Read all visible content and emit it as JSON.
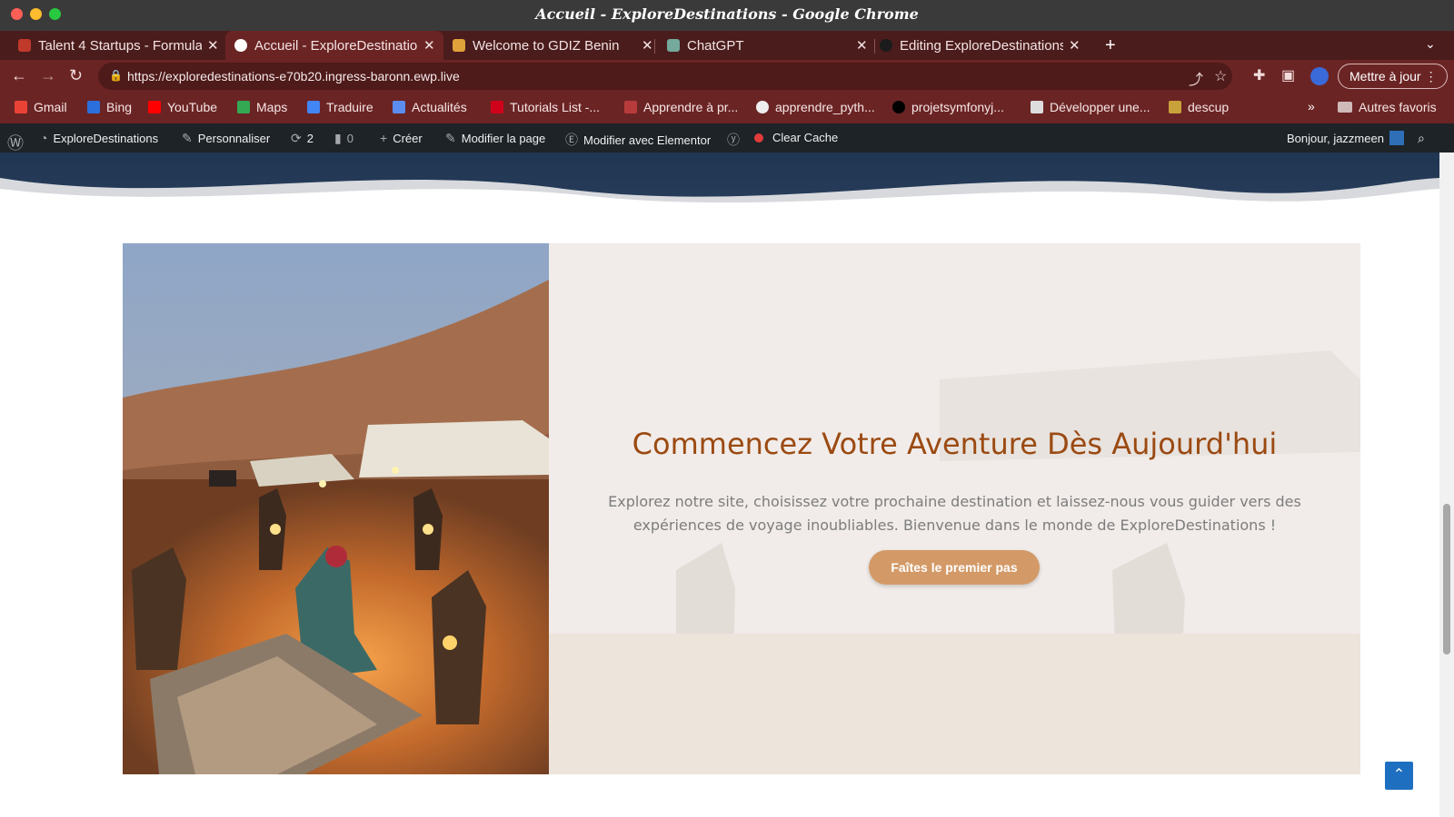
{
  "window": {
    "title": "Accueil - ExploreDestinations - Google Chrome"
  },
  "tabs": [
    {
      "label": "Talent 4 Startups - Formulaire",
      "icon": "heart-favicon"
    },
    {
      "label": "Accueil - ExploreDestinations",
      "icon": "globe-favicon",
      "active": true
    },
    {
      "label": "Welcome to GDIZ Benin",
      "icon": "gdiz-favicon"
    },
    {
      "label": "ChatGPT",
      "icon": "chatgpt-favicon"
    },
    {
      "label": "Editing ExploreDestinations",
      "icon": "github-favicon"
    }
  ],
  "toolbar": {
    "url": "https://exploredestinations-e70b20.ingress-baronn.ewp.live",
    "update_label": "Mettre à jour"
  },
  "bookmarks": {
    "items": [
      "Gmail",
      "Bing",
      "YouTube",
      "Maps",
      "Traduire",
      "Actualités",
      "Tutorials List -...",
      "Apprendre à pr...",
      "apprendre_pyth...",
      "projetsymfonyj...",
      "Développer une...",
      "descup"
    ],
    "more": "»",
    "other": "Autres favoris"
  },
  "wpbar": {
    "site": "ExploreDestinations",
    "customize": "Personnaliser",
    "updates": "2",
    "comments": "0",
    "new": "Créer",
    "edit": "Modifier la page",
    "elementor": "Modifier avec Elementor",
    "cache": "Clear Cache",
    "greeting": "Bonjour, jazzmeen"
  },
  "cta": {
    "title": "Commencez Votre Aventure Dès Aujourd'hui",
    "text": "Explorez notre site, choisissez votre prochaine destination et laissez-nous vous guider vers des expériences de voyage inoubliables. Bienvenue dans le monde de ExploreDestinations !",
    "button": "Faîtes le premier pas"
  },
  "colors": {
    "title": "#9b4a12",
    "button": "#d39a67",
    "tab_bar": "#4b1c1c",
    "toolbar": "#6b2424",
    "wp_bar": "#1d2327"
  }
}
